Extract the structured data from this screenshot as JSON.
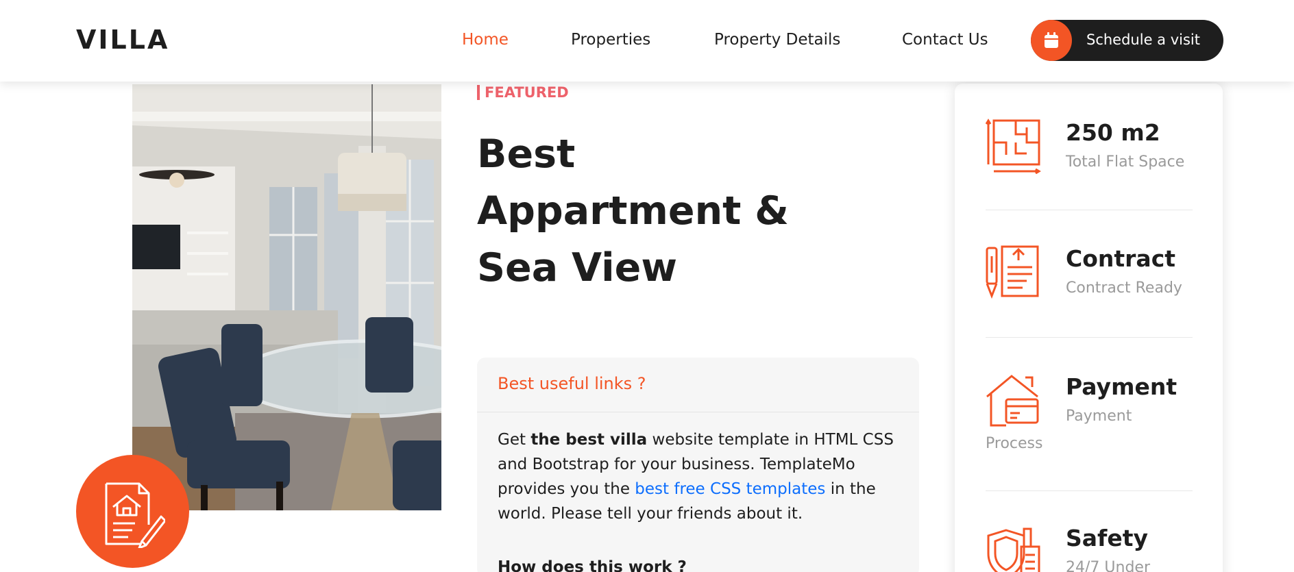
{
  "header": {
    "logo": "VILLA",
    "nav": [
      {
        "label": "Home",
        "active": true
      },
      {
        "label": "Properties",
        "active": false
      },
      {
        "label": "Property Details",
        "active": false
      },
      {
        "label": "Contact Us",
        "active": false
      }
    ],
    "cta_label": "Schedule a visit",
    "cta_icon": "calendar-icon"
  },
  "main": {
    "tag": "FEATURED",
    "title_lines": [
      "Best",
      "Appartment &",
      "Sea View"
    ],
    "photo_alt_icon": "apartment-photo",
    "badge_icon": "document-house-pen-icon"
  },
  "accordion": {
    "heading": "Best useful links ?",
    "body": {
      "p1": "Get ",
      "bold": "the best villa",
      "p2": " website template in HTML CSS and Bootstrap for your business. TemplateMo provides you the ",
      "link": "best free CSS templates",
      "p3": " in the world. Please tell your friends about it."
    },
    "next_heading": "How does this work ?"
  },
  "info": [
    {
      "icon": "floor-plan-icon",
      "value": "250 m2",
      "label": "Total Flat Space"
    },
    {
      "icon": "contract-pen-icon",
      "value": "Contract",
      "label": "Contract Ready"
    },
    {
      "icon": "house-payment-card-icon",
      "value": "Payment",
      "label_line1": "Payment",
      "label_line2": "Process"
    },
    {
      "icon": "shield-building-icon",
      "value": "Safety",
      "label": "24/7 Under"
    }
  ],
  "colors": {
    "accent": "#f35525",
    "featured": "#ee626b",
    "dark": "#1e1e1e",
    "muted": "#9a9a9a",
    "link": "#0d6efd"
  }
}
